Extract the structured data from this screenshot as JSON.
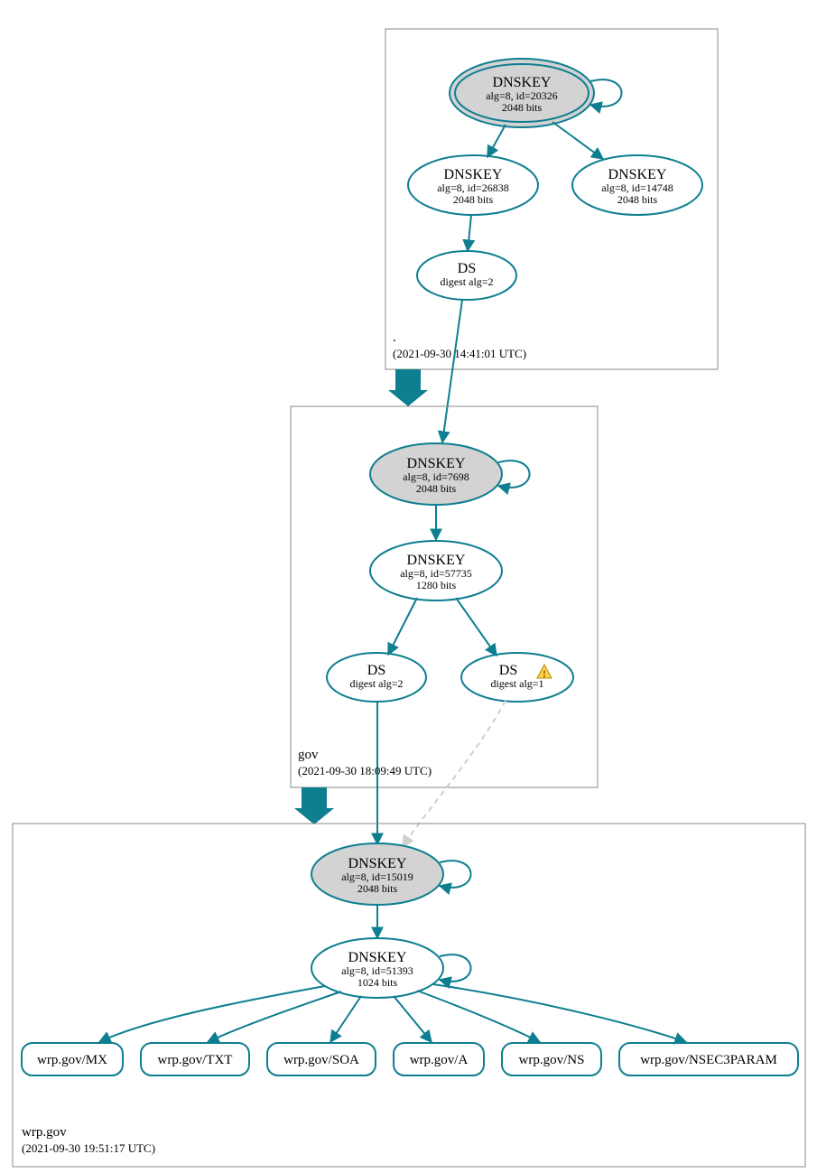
{
  "zones": {
    "root": {
      "name": ".",
      "timestamp": "(2021-09-30 14:41:01 UTC)"
    },
    "gov": {
      "name": "gov",
      "timestamp": "(2021-09-30 18:09:49 UTC)"
    },
    "wrp": {
      "name": "wrp.gov",
      "timestamp": "(2021-09-30 19:51:17 UTC)"
    }
  },
  "nodes": {
    "root_ksk": {
      "title": "DNSKEY",
      "l1": "alg=8, id=20326",
      "l2": "2048 bits"
    },
    "root_zsk1": {
      "title": "DNSKEY",
      "l1": "alg=8, id=26838",
      "l2": "2048 bits"
    },
    "root_zsk2": {
      "title": "DNSKEY",
      "l1": "alg=8, id=14748",
      "l2": "2048 bits"
    },
    "root_ds": {
      "title": "DS",
      "l1": "digest alg=2"
    },
    "gov_ksk": {
      "title": "DNSKEY",
      "l1": "alg=8, id=7698",
      "l2": "2048 bits"
    },
    "gov_zsk": {
      "title": "DNSKEY",
      "l1": "alg=8, id=57735",
      "l2": "1280 bits"
    },
    "gov_ds1": {
      "title": "DS",
      "l1": "digest alg=2"
    },
    "gov_ds2": {
      "title": "DS",
      "l1": "digest alg=1"
    },
    "wrp_ksk": {
      "title": "DNSKEY",
      "l1": "alg=8, id=15019",
      "l2": "2048 bits"
    },
    "wrp_zsk": {
      "title": "DNSKEY",
      "l1": "alg=8, id=51393",
      "l2": "1024 bits"
    }
  },
  "rr": {
    "mx": "wrp.gov/MX",
    "txt": "wrp.gov/TXT",
    "soa": "wrp.gov/SOA",
    "a": "wrp.gov/A",
    "ns": "wrp.gov/NS",
    "nsec": "wrp.gov/NSEC3PARAM"
  },
  "warnings": {
    "gov_ds2": true
  }
}
